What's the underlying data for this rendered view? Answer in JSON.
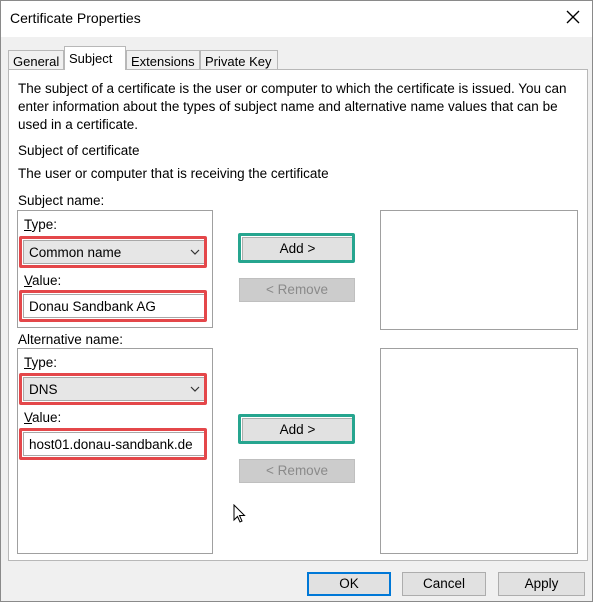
{
  "window": {
    "title": "Certificate Properties"
  },
  "tabs": [
    {
      "label": "General"
    },
    {
      "label": "Subject"
    },
    {
      "label": "Extensions"
    },
    {
      "label": "Private Key"
    }
  ],
  "panel": {
    "description": "The subject of a certificate is the user or computer to which the certificate is issued. You can enter information about the types of subject name and alternative name values that can be used in a certificate.",
    "subject_of_certificate": "Subject of certificate",
    "subject_sub": "The user or computer that is receiving the certificate",
    "subject_name": {
      "group_label": "Subject name:",
      "type_label": "Type:",
      "type_value": "Common name",
      "value_label": "Value:",
      "value_text": "Donau Sandbank AG",
      "add_label": "Add >",
      "remove_label": "< Remove"
    },
    "alternative_name": {
      "group_label": "Alternative name:",
      "type_label": "Type:",
      "type_value": "DNS",
      "value_label": "Value:",
      "value_text": "host01.donau-sandbank.de",
      "add_label": "Add >",
      "remove_label": "< Remove"
    }
  },
  "footer": {
    "ok_label": "OK",
    "cancel_label": "Cancel",
    "apply_label": "Apply"
  },
  "colors": {
    "highlight_red": "#e4474a",
    "highlight_green": "#26a58f",
    "default_button_border": "#0078d7"
  },
  "icons": {
    "close": "close-icon",
    "dropdown": "chevron-down-icon",
    "cursor": "mouse-cursor-icon"
  }
}
